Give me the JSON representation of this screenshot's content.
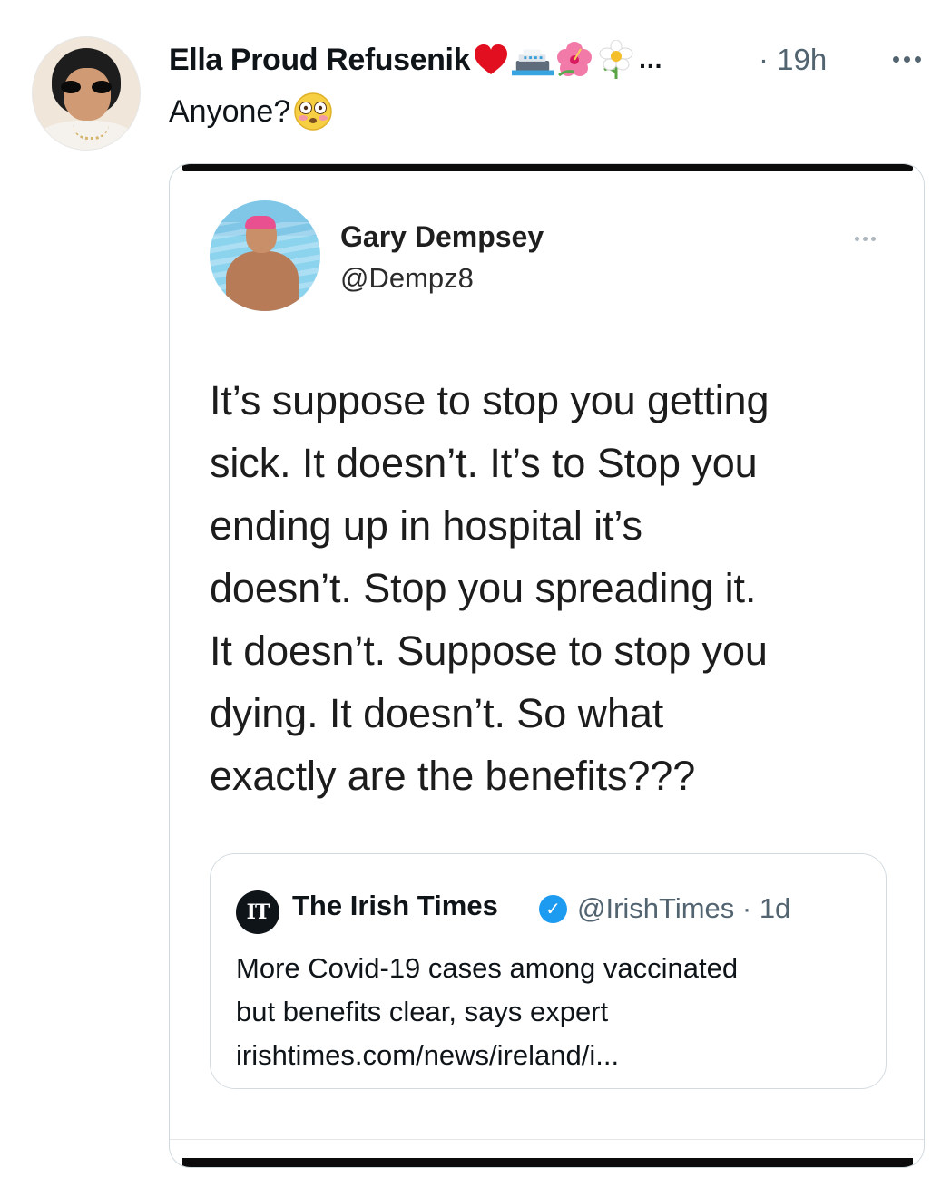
{
  "tweet": {
    "author_name": "Ella Proud Refusenik",
    "name_emojis": [
      "❤️",
      "🚢",
      "🌺",
      "🌼"
    ],
    "name_overflow": "...",
    "timestamp": "· 19h",
    "text": "Anyone?",
    "text_emoji": "😳"
  },
  "quoted_image": {
    "author_name": "Gary Dempsey",
    "author_handle": "@Dempz8",
    "body_lines": [
      "It’s suppose to stop you getting",
      "sick. It doesn’t. It’s to Stop you",
      "ending up in hospital it’s",
      "doesn’t. Stop you spreading it.",
      "It doesn’t. Suppose to stop you",
      "dying. It doesn’t. So what",
      "exactly are the benefits???"
    ],
    "quote": {
      "logo_text": "IT",
      "author_name": "The Irish Times",
      "verified_mark": "✓",
      "meta": "@IrishTimes · 1d",
      "text_lines": [
        "More Covid-19 cases among vaccinated",
        "but benefits clear, says expert",
        "irishtimes.com/news/ireland/i..."
      ]
    }
  },
  "colors": {
    "text": "#0f1419",
    "secondary": "#536471",
    "verified": "#1d9bf0",
    "border": "#cfd9de"
  },
  "icons": [
    "more-icon",
    "verified-badge-icon"
  ]
}
